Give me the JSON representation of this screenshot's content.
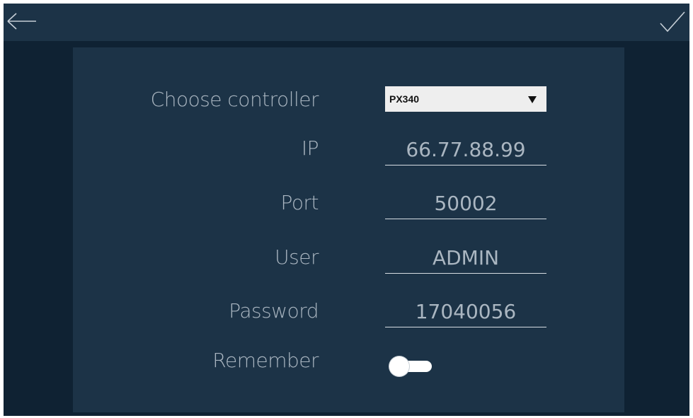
{
  "toolbar": {
    "back_icon": "arrow-left-icon",
    "confirm_icon": "checkmark-icon"
  },
  "form": {
    "controller": {
      "label": "Choose controller",
      "selected": "PX340"
    },
    "ip": {
      "label": "IP",
      "value": "66.77.88.99"
    },
    "port": {
      "label": "Port",
      "value": "50002"
    },
    "user": {
      "label": "User",
      "value": "ADMIN"
    },
    "password": {
      "label": "Password",
      "value": "17040056"
    },
    "remember": {
      "label": "Remember",
      "checked": false
    }
  },
  "colors": {
    "background": "#0f2233",
    "surface": "#1c3347",
    "text": "#aab6c1",
    "select_bg": "#eeeeee"
  }
}
